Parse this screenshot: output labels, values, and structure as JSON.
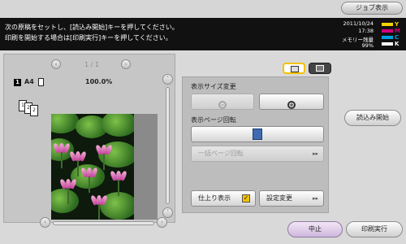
{
  "header": {
    "job_button": "ジョブ表示",
    "message_line1": "次の原稿をセットし、[読込み開始]キーを押してください。",
    "message_line2": "印刷を開始する場合は[印刷実行]キーを押してください。",
    "date": "2011/10/24",
    "time": "17:38",
    "memory_label": "メモリー残量",
    "memory_value": "99%",
    "toner": [
      {
        "label": "Y",
        "color": "#f2d400"
      },
      {
        "label": "M",
        "color": "#d1007a"
      },
      {
        "label": "C",
        "color": "#009fe0"
      },
      {
        "label": "K",
        "color": "#ffffff"
      }
    ]
  },
  "preview": {
    "page_indicator": "1 / 1",
    "sheet_number": "1",
    "paper_size": "A4",
    "zoom": "100.0%",
    "stack_pages": [
      "1",
      "2",
      "2"
    ]
  },
  "view_tabs": {
    "active_icon": "preview-detail-icon",
    "inactive_icon": "preview-thumbnail-icon"
  },
  "settings": {
    "display_size_label": "表示サイズ変更",
    "zoom_out_icon": "zoom-out-icon",
    "zoom_in_icon": "zoom-in-icon",
    "page_rotation_label": "表示ページ回転",
    "rotate_icon": "rotate-page-icon",
    "batch_rotation_button": "一括ページ回転",
    "finish_display_button": "仕上り表示",
    "setting_change_button": "設定変更"
  },
  "actions": {
    "start_scan": "読込み開始",
    "stop": "中止",
    "print": "印刷実行"
  }
}
